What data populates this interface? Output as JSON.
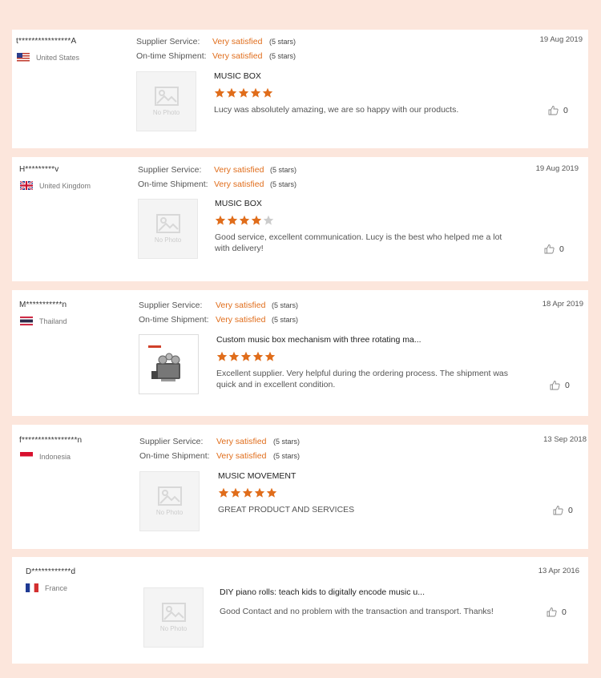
{
  "labels": {
    "supplier_service": "Supplier Service:",
    "ontime_shipment": "On-time Shipment:"
  },
  "colors": {
    "accent": "#e06d1b",
    "background": "#fce6dc",
    "star_empty": "#cccccc"
  },
  "reviews": [
    {
      "user": "t****************A",
      "country": "United States",
      "flag": "us-flag",
      "supplier_service": "Very satisfied",
      "supplier_stars": "(5 stars)",
      "ontime_shipment": "Very satisfied",
      "ontime_stars": "(5 stars)",
      "date": "19 Aug 2019",
      "thumb_text": "No Photo",
      "product": "MUSIC BOX",
      "rating": 5,
      "comment": "Lucy was absolutely amazing, we are so happy with our products.",
      "likes": "0"
    },
    {
      "user": "H*********v",
      "country": "United Kingdom",
      "flag": "uk-flag",
      "supplier_service": "Very satisfied",
      "supplier_stars": "(5 stars)",
      "ontime_shipment": "Very satisfied",
      "ontime_stars": "(5 stars)",
      "date": "19 Aug 2019",
      "thumb_text": "No Photo",
      "product": "MUSIC BOX",
      "rating": 4,
      "comment": "Good service, excellent communication. Lucy is the best who helped me a lot with delivery!",
      "likes": "0"
    },
    {
      "user": "M***********n",
      "country": "Thailand",
      "flag": "thailand-flag",
      "supplier_service": "Very satisfied",
      "supplier_stars": "(5 stars)",
      "ontime_shipment": "Very satisfied",
      "ontime_stars": "(5 stars)",
      "date": "18 Apr 2019",
      "thumb_text": "",
      "product": "Custom music box mechanism with three rotating ma...",
      "rating": 5,
      "comment": "Excellent supplier. Very helpful during the ordering process. The shipment was quick and  in excellent condition.",
      "likes": "0"
    },
    {
      "user": "f*****************n",
      "country": "Indonesia",
      "flag": "indonesia-flag",
      "supplier_service": "Very satisfied",
      "supplier_stars": "(5 stars)",
      "ontime_shipment": "Very satisfied",
      "ontime_stars": "(5 stars)",
      "date": "13 Sep 2018",
      "thumb_text": "No Photo",
      "product": "MUSIC MOVEMENT",
      "rating": 5,
      "comment": "GREAT PRODUCT AND SERVICES",
      "likes": "0"
    },
    {
      "user": "D************d",
      "country": "France",
      "flag": "france-flag",
      "date": "13 Apr 2016",
      "thumb_text": "No Photo",
      "product": "DIY piano rolls: teach kids to digitally encode music u...",
      "comment": "Good Contact and no problem with the transaction and transport. Thanks!",
      "likes": "0"
    }
  ]
}
